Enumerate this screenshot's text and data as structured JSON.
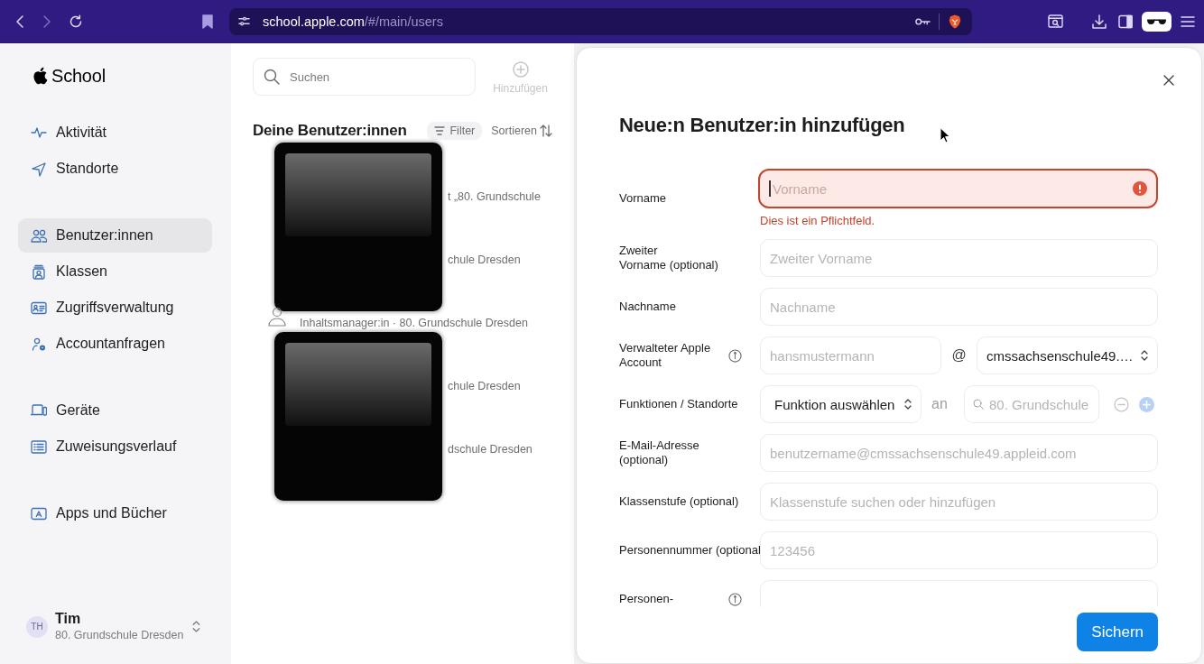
{
  "browser": {
    "url_host": "school.apple.com",
    "url_path": "/#/main/users"
  },
  "sidebar": {
    "logo_text": "School",
    "sections": [
      {
        "items": [
          {
            "kind": "activity",
            "label": "Aktivität",
            "selected": false
          },
          {
            "kind": "locations",
            "label": "Standorte",
            "selected": false
          }
        ]
      },
      {
        "items": [
          {
            "kind": "users",
            "label": "Benutzer:innen",
            "selected": true
          },
          {
            "kind": "classes",
            "label": "Klassen",
            "selected": false
          },
          {
            "kind": "access",
            "label": "Zugriffsverwaltung",
            "selected": false
          },
          {
            "kind": "requests",
            "label": "Accountanfragen",
            "selected": false
          }
        ]
      },
      {
        "items": [
          {
            "kind": "devices",
            "label": "Geräte",
            "selected": false
          },
          {
            "kind": "history",
            "label": "Zuweisungsverlauf",
            "selected": false
          }
        ]
      },
      {
        "items": [
          {
            "kind": "apps",
            "label": "Apps und Bücher",
            "selected": false
          }
        ]
      }
    ],
    "account": {
      "initials": "TH",
      "name": "Tim",
      "school": "80. Grundschule Dresden"
    }
  },
  "users_panel": {
    "search_placeholder": "Suchen",
    "add_label": "Hinzufügen",
    "add_disabled": true,
    "title": "Deine Benutzer:innen",
    "filter_label": "Filter",
    "sort_label": "Sortieren",
    "groups": [
      {
        "covered": true,
        "rows": [
          {
            "subtitle": "t „80. Grundschule"
          },
          {
            "subtitle": "chule Dresden"
          }
        ]
      },
      {
        "covered": false,
        "rows": [
          {
            "subtitle": "Inhaltsmanager:in · 80. Grundschule Dresden"
          }
        ]
      },
      {
        "covered": true,
        "rows": [
          {
            "subtitle": "chule Dresden"
          },
          {
            "subtitle": "dschule Dresden"
          }
        ]
      }
    ]
  },
  "dialog": {
    "title": "Neue:n Benutzer:in hinzufügen",
    "fields": [
      {
        "kind": "text",
        "label": [
          "Vorname"
        ],
        "info": false,
        "placeholder": "Vorname",
        "focused": true,
        "invalid": true,
        "error": "Dies ist ein Pflichtfeld."
      },
      {
        "kind": "text",
        "label": [
          "Zweiter",
          "Vorname (optional)"
        ],
        "info": false,
        "placeholder": "Zweiter Vorname",
        "focused": false,
        "invalid": false
      },
      {
        "kind": "text",
        "label": [
          "Nachname"
        ],
        "info": false,
        "placeholder": "Nachname",
        "focused": false,
        "invalid": false
      },
      {
        "kind": "account",
        "label": [
          "Verwalteter Apple",
          "Account"
        ],
        "info": true,
        "placeholder": "hansmustermann",
        "separator": "@",
        "domain": "cmssachsenschule49.…"
      },
      {
        "kind": "role",
        "label": [
          "Funktionen / Standorte"
        ],
        "info": false,
        "role": "Funktion auswählen",
        "connector": "an",
        "location_placeholder": "80. Grundschule",
        "add_disabled": true
      },
      {
        "kind": "text",
        "label": [
          "E-Mail-Adresse",
          "(optional)"
        ],
        "info": false,
        "placeholder": "benutzername@cmssachsenschule49.appleid.com",
        "focused": false,
        "invalid": false
      },
      {
        "kind": "text",
        "label": [
          "Klassenstufe (optional)"
        ],
        "info": false,
        "placeholder": "Klassenstufe suchen oder hinzufügen",
        "focused": false,
        "invalid": false
      },
      {
        "kind": "text",
        "label": [
          "Personennummer (optional"
        ],
        "info": false,
        "placeholder": "123456",
        "focused": false,
        "invalid": false
      },
      {
        "kind": "text",
        "label": [
          "Personen-"
        ],
        "info": true,
        "focused": false,
        "invalid": false
      }
    ],
    "save_label": "Sichern"
  }
}
